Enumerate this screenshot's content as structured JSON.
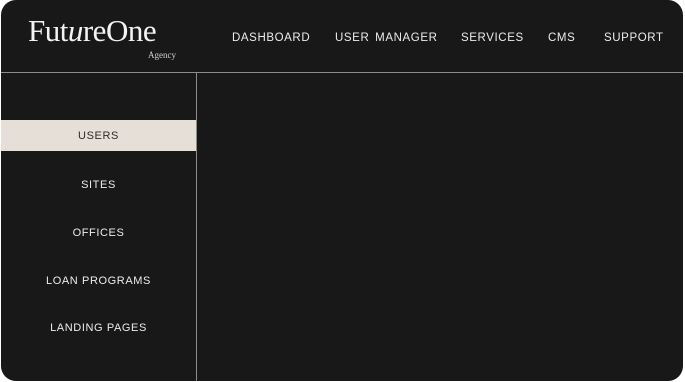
{
  "brand": {
    "name_part1": "Fut",
    "name_italic": "u",
    "name_part2": "reOne",
    "tagline": "Agency"
  },
  "nav": {
    "items": [
      {
        "label": "DASHBOARD"
      },
      {
        "label": "USER  MANAGER"
      },
      {
        "label": "SERVICES"
      },
      {
        "label": "CMS"
      },
      {
        "label": "SUPPORT"
      }
    ]
  },
  "sidebar": {
    "items": [
      {
        "label": "USERS",
        "active": true
      },
      {
        "label": "SITES",
        "active": false
      },
      {
        "label": "OFFICES",
        "active": false
      },
      {
        "label": "LOAN PROGRAMS",
        "active": false
      },
      {
        "label": "LANDING PAGES",
        "active": false
      }
    ]
  },
  "colors": {
    "background": "#181818",
    "divider": "#8c8c8c",
    "active_item_bg": "#e6dfd8",
    "text": "#ececec"
  }
}
